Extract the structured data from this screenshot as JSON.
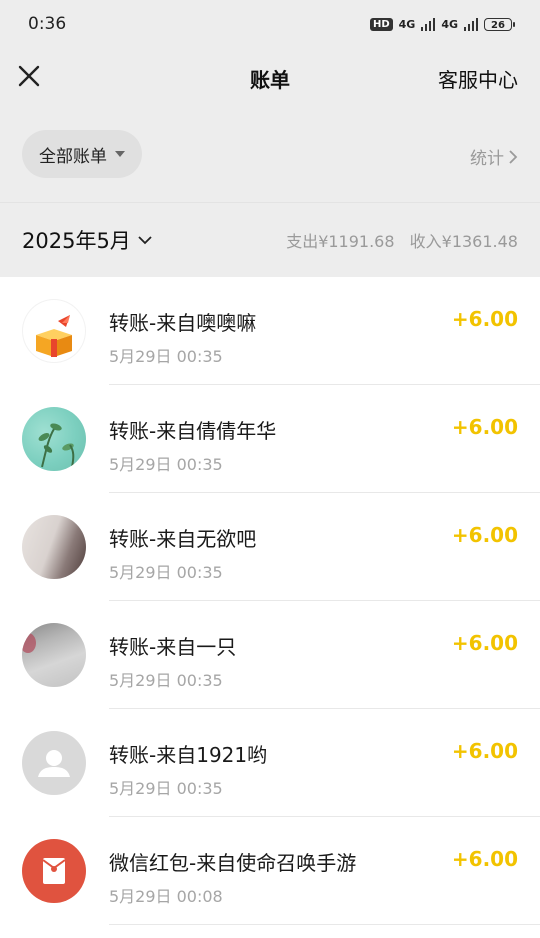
{
  "status_bar": {
    "time": "0:36",
    "hd": "HD",
    "net1": "4G",
    "net2": "4G",
    "battery": "26"
  },
  "nav": {
    "title": "账单",
    "right_label": "客服中心"
  },
  "filter": {
    "label": "全部账单",
    "stats_label": "统计"
  },
  "month": {
    "label": "2025年5月",
    "expense": "支出¥1191.68",
    "income": "收入¥1361.48"
  },
  "colors": {
    "amount": "#f2c300",
    "background": "#ededed",
    "redpacket": "#e0533f"
  },
  "transactions": [
    {
      "title": "转账-来自噢噢嘛",
      "time": "5月29日 00:35",
      "amount": "+6.00",
      "avatar": "gift-box-avatar"
    },
    {
      "title": "转账-来自倩倩年华",
      "time": "5月29日 00:35",
      "amount": "+6.00",
      "avatar": "plant-photo-avatar"
    },
    {
      "title": "转账-来自无欲吧",
      "time": "5月29日 00:35",
      "amount": "+6.00",
      "avatar": "photo-avatar"
    },
    {
      "title": "转账-来自一只",
      "time": "5月29日 00:35",
      "amount": "+6.00",
      "avatar": "photo-avatar"
    },
    {
      "title": "转账-来自1921哟",
      "time": "5月29日 00:35",
      "amount": "+6.00",
      "avatar": "default-user-avatar"
    },
    {
      "title": "微信红包-来自使命召唤手游",
      "time": "5月29日 00:08",
      "amount": "+6.00",
      "avatar": "red-packet-icon"
    }
  ]
}
